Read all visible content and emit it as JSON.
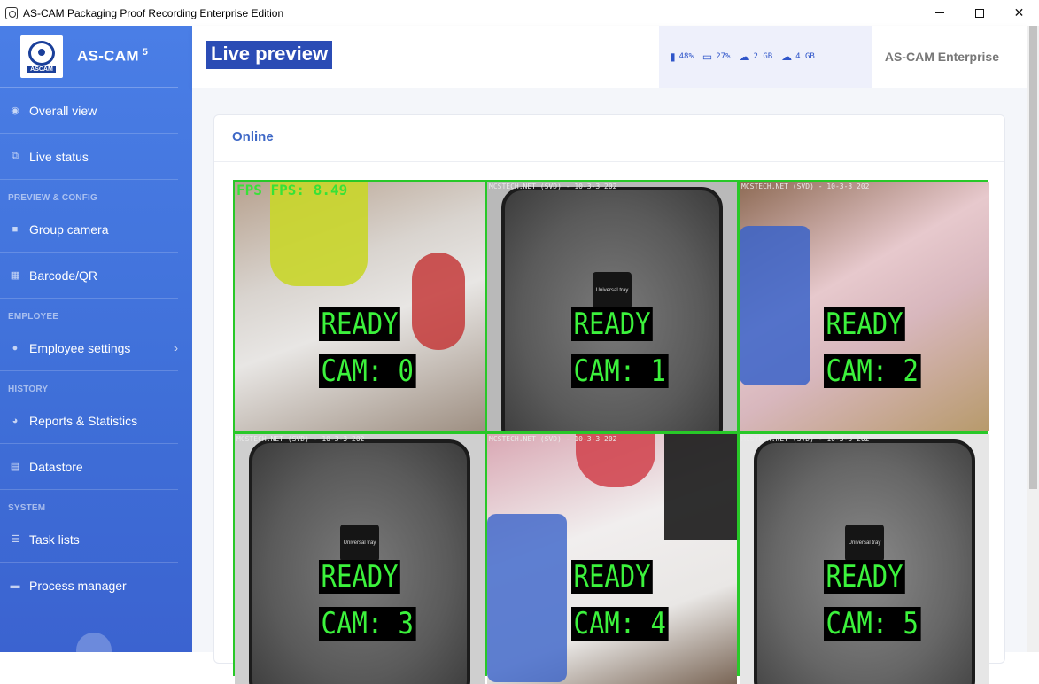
{
  "window": {
    "title": "AS-CAM Packaging Proof Recording Enterprise Edition"
  },
  "sidebar": {
    "brand": {
      "logo_text": "ASCAM",
      "name": "AS-CAM",
      "version": "5"
    },
    "items": [
      {
        "label": "Overall view",
        "icon": "eye-icon"
      },
      {
        "label": "Live status",
        "icon": "network-icon"
      },
      {
        "section": "PREVIEW & CONFIG"
      },
      {
        "label": "Group camera",
        "icon": "video-camera-icon"
      },
      {
        "label": "Barcode/QR",
        "icon": "qr-grid-icon"
      },
      {
        "section": "EMPLOYEE"
      },
      {
        "label": "Employee settings",
        "icon": "users-icon"
      },
      {
        "section": "HISTORY"
      },
      {
        "label": "Reports & Statistics",
        "icon": "pie-chart-icon"
      },
      {
        "label": "Datastore",
        "icon": "database-icon"
      },
      {
        "section": "SYSTEM"
      },
      {
        "label": "Task lists",
        "icon": "list-icon"
      },
      {
        "label": "Process manager",
        "icon": "window-icon"
      }
    ]
  },
  "header": {
    "title": "Live preview",
    "stats": {
      "cpu": "48%",
      "ram": "27%",
      "upload": "2 GB",
      "download": "4 GB"
    },
    "edition": "AS-CAM Enterprise"
  },
  "main": {
    "card_title": "Online",
    "fps_overlay": "FPS FPS: 8.49",
    "cameras": [
      {
        "status": "READY",
        "cam": "CAM: 0",
        "stamp": ""
      },
      {
        "status": "READY",
        "cam": "CAM: 1",
        "stamp": "MCSTECH.NET (SVD) - 10-3-3 202",
        "puck": "Universal tray"
      },
      {
        "status": "READY",
        "cam": "CAM: 2",
        "stamp": "MCSTECH.NET (SVD) - 10-3-3 202"
      },
      {
        "status": "READY",
        "cam": "CAM: 3",
        "stamp": "MCSTECH.NET (SVD) - 10-3-3 202",
        "puck": "Universal tray"
      },
      {
        "status": "READY",
        "cam": "CAM: 4",
        "stamp": "MCSTECH.NET (SVD) - 10-3-3 202"
      },
      {
        "status": "READY",
        "cam": "CAM: 5",
        "stamp": "MCSTECH.NET (SVD) - 10-3-3 202",
        "puck": "Universal tray"
      }
    ]
  },
  "colors": {
    "sidebar_top": "#4a7ee6",
    "sidebar_bottom": "#3b63d0",
    "title_bg": "#2b4cb5",
    "label_green": "#3cf23c",
    "grid_border": "#28c828"
  }
}
